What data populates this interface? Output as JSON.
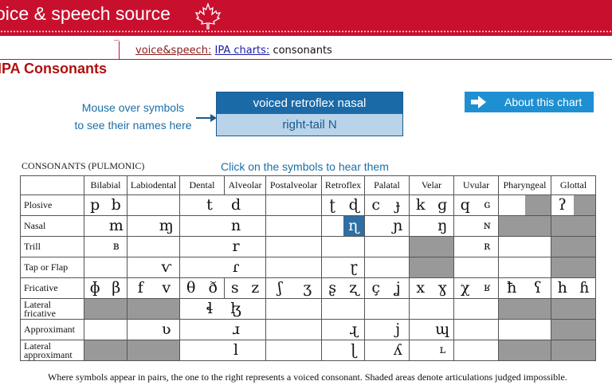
{
  "banner": {
    "title": "oice & speech source"
  },
  "breadcrumb": {
    "item1": "voice&speech:",
    "item2": "IPA charts:",
    "current": "consonants"
  },
  "page": {
    "title": "IPA Consonants"
  },
  "hint": {
    "line1": "Mouse over symbols",
    "line2": "to see their names here"
  },
  "namebox": {
    "name": "voiced retroflex nasal",
    "alt": "right-tail N"
  },
  "about": {
    "label": "About this chart"
  },
  "table_title": "CONSONANTS (PULMONIC)",
  "click_hint": "Click on the symbols to hear them",
  "columns": [
    "Bilabial",
    "Labiodental",
    "Dental",
    "Alveolar",
    "Postalveolar",
    "Retroflex",
    "Palatal",
    "Velar",
    "Uvular",
    "Pharyngeal",
    "Glottal"
  ],
  "rows": [
    "Plosive",
    "Nasal",
    "Trill",
    "Tap or Flap",
    "Fricative",
    "Lateral fricative",
    "Approximant",
    "Lateral approximant"
  ],
  "symbols": {
    "plosive": {
      "bilabial": [
        "p",
        "b"
      ],
      "alveolar": [
        "t",
        "d"
      ],
      "retroflex": [
        "ʈ",
        "ɖ"
      ],
      "palatal": [
        "c",
        "ɟ"
      ],
      "velar": [
        "k",
        "ɡ"
      ],
      "uvular": [
        "q",
        "ɢ"
      ],
      "glottal": [
        "ʔ",
        ""
      ]
    },
    "nasal": {
      "bilabial": "m",
      "labiodental": "ɱ",
      "alveolar": "n",
      "retroflex": "ɳ",
      "palatal": "ɲ",
      "velar": "ŋ",
      "uvular": "ɴ"
    },
    "trill": {
      "bilabial": "ʙ",
      "alveolar": "r",
      "uvular": "ʀ"
    },
    "tap": {
      "labiodental": "ⱱ",
      "alveolar": "ɾ",
      "retroflex": "ɽ"
    },
    "fricative": {
      "bilabial": [
        "ɸ",
        "β"
      ],
      "labiodental": [
        "f",
        "v"
      ],
      "dental": [
        "θ",
        "ð"
      ],
      "alveolar": [
        "s",
        "z"
      ],
      "postalveolar": [
        "ʃ",
        "ʒ"
      ],
      "retroflex": [
        "ʂ",
        "ʐ"
      ],
      "palatal": [
        "ç",
        "ʝ"
      ],
      "velar": [
        "x",
        "ɣ"
      ],
      "uvular": [
        "χ",
        "ʁ"
      ],
      "pharyngeal": [
        "ħ",
        "ʕ"
      ],
      "glottal": [
        "h",
        "ɦ"
      ]
    },
    "lateral_fricative": {
      "alveolar": [
        "ɬ",
        "ɮ"
      ]
    },
    "approximant": {
      "labiodental": "ʋ",
      "alveolar": "ɹ",
      "retroflex": "ɻ",
      "palatal": "j",
      "velar": "ɰ"
    },
    "lateral_approximant": {
      "alveolar": "l",
      "retroflex": "ɭ",
      "palatal": "ʎ",
      "velar": "ʟ"
    }
  },
  "footer": "Where symbols appear in pairs, the one to the right represents a voiced  consonant. Shaded areas denote articulations judged impossible.",
  "colors": {
    "banner": "#c8102e",
    "title": "#b01010",
    "link_blue": "#1b6fa8",
    "highlight": "#2f6fa3",
    "shaded": "#999999"
  }
}
